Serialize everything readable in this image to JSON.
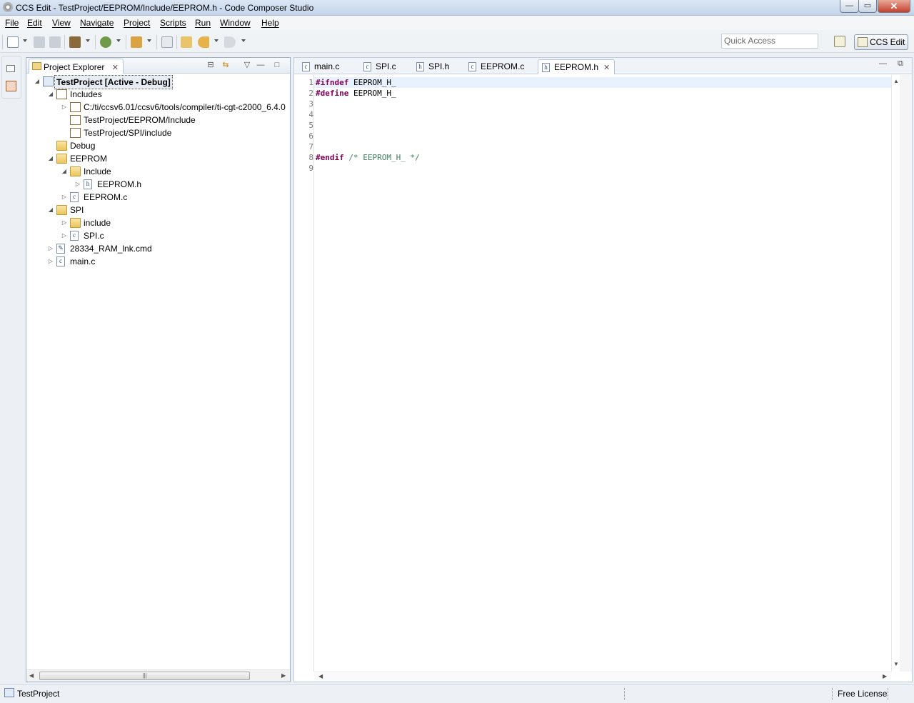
{
  "window": {
    "title": "CCS Edit - TestProject/EEPROM/Include/EEPROM.h - Code Composer Studio",
    "min_glyph": "—",
    "max_glyph": "▭",
    "close_glyph": "✕"
  },
  "menubar": [
    "File",
    "Edit",
    "View",
    "Navigate",
    "Project",
    "Scripts",
    "Run",
    "Window",
    "Help"
  ],
  "toolbar": {
    "quick_access_placeholder": "Quick Access",
    "perspective_label": "CCS Edit"
  },
  "project_explorer": {
    "title": "Project Explorer",
    "tree": [
      {
        "label": "TestProject  [Active - Debug]",
        "depth": 0,
        "twisty": "expanded",
        "icon": "project-icon",
        "selected": true
      },
      {
        "label": "Includes",
        "depth": 1,
        "twisty": "expanded",
        "icon": "includes-icon"
      },
      {
        "label": "C:/ti/ccsv6.01/ccsv6/tools/compiler/ti-cgt-c2000_6.4.0",
        "depth": 2,
        "twisty": "collapsed",
        "icon": "include-folder-icon"
      },
      {
        "label": "TestProject/EEPROM/Include",
        "depth": 2,
        "twisty": "none",
        "icon": "include-folder-icon"
      },
      {
        "label": "TestProject/SPI/include",
        "depth": 2,
        "twisty": "none",
        "icon": "include-folder-icon"
      },
      {
        "label": "Debug",
        "depth": 1,
        "twisty": "none",
        "icon": "folder-icon"
      },
      {
        "label": "EEPROM",
        "depth": 1,
        "twisty": "expanded",
        "icon": "folder-icon"
      },
      {
        "label": "Include",
        "depth": 2,
        "twisty": "expanded",
        "icon": "folder-icon"
      },
      {
        "label": "EEPROM.h",
        "depth": 3,
        "twisty": "collapsed",
        "icon": "h-file-icon"
      },
      {
        "label": "EEPROM.c",
        "depth": 2,
        "twisty": "collapsed",
        "icon": "c-file-icon"
      },
      {
        "label": "SPI",
        "depth": 1,
        "twisty": "expanded",
        "icon": "folder-icon"
      },
      {
        "label": "include",
        "depth": 2,
        "twisty": "collapsed",
        "icon": "folder-icon"
      },
      {
        "label": "SPI.c",
        "depth": 2,
        "twisty": "collapsed",
        "icon": "c-file-icon"
      },
      {
        "label": "28334_RAM_lnk.cmd",
        "depth": 1,
        "twisty": "collapsed",
        "icon": "cmd-file-icon"
      },
      {
        "label": "main.c",
        "depth": 1,
        "twisty": "collapsed",
        "icon": "c-file-icon"
      }
    ]
  },
  "editor": {
    "tabs": [
      {
        "label": "main.c",
        "type": "c",
        "active": false
      },
      {
        "label": "SPI.c",
        "type": "c",
        "active": false
      },
      {
        "label": "SPI.h",
        "type": "h",
        "active": false
      },
      {
        "label": "EEPROM.c",
        "type": "c",
        "active": false
      },
      {
        "label": "EEPROM.h",
        "type": "h",
        "active": true
      }
    ],
    "lines": [
      {
        "num": "1",
        "tokens": [
          {
            "t": "#ifndef",
            "c": "kw"
          },
          {
            "t": " EEPROM_H_",
            "c": ""
          }
        ]
      },
      {
        "num": "2",
        "tokens": [
          {
            "t": "#define",
            "c": "kw"
          },
          {
            "t": " EEPROM_H_",
            "c": ""
          }
        ]
      },
      {
        "num": "3",
        "tokens": []
      },
      {
        "num": "4",
        "tokens": []
      },
      {
        "num": "5",
        "tokens": []
      },
      {
        "num": "6",
        "tokens": []
      },
      {
        "num": "7",
        "tokens": []
      },
      {
        "num": "8",
        "tokens": [
          {
            "t": "#endif",
            "c": "kw"
          },
          {
            "t": " /* EEPROM_H_ */",
            "c": "cm"
          }
        ]
      },
      {
        "num": "9",
        "tokens": []
      }
    ],
    "current_line": 1
  },
  "statusbar": {
    "project": "TestProject",
    "license": "Free License"
  },
  "colors": {
    "keyword": "#7f0055",
    "comment": "#3f7f5f",
    "current_line": "#e8f2fe"
  }
}
